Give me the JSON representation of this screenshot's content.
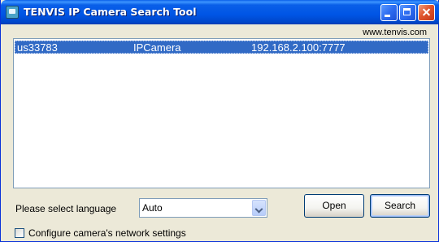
{
  "window": {
    "title": "TENVIS IP Camera Search Tool",
    "icon": "camera-app-icon"
  },
  "header": {
    "website": "www.tenvis.com"
  },
  "devices": [
    {
      "id": "us33783",
      "type": "IPCamera",
      "address": "192.168.2.100:7777",
      "selected": true
    }
  ],
  "language": {
    "label": "Please select language",
    "selected": "Auto"
  },
  "buttons": {
    "open": "Open",
    "search": "Search"
  },
  "configure": {
    "label": "Configure camera's network settings",
    "checked": false
  },
  "colors": {
    "selection": "#316ac5",
    "titlebar": "#0055e5"
  }
}
